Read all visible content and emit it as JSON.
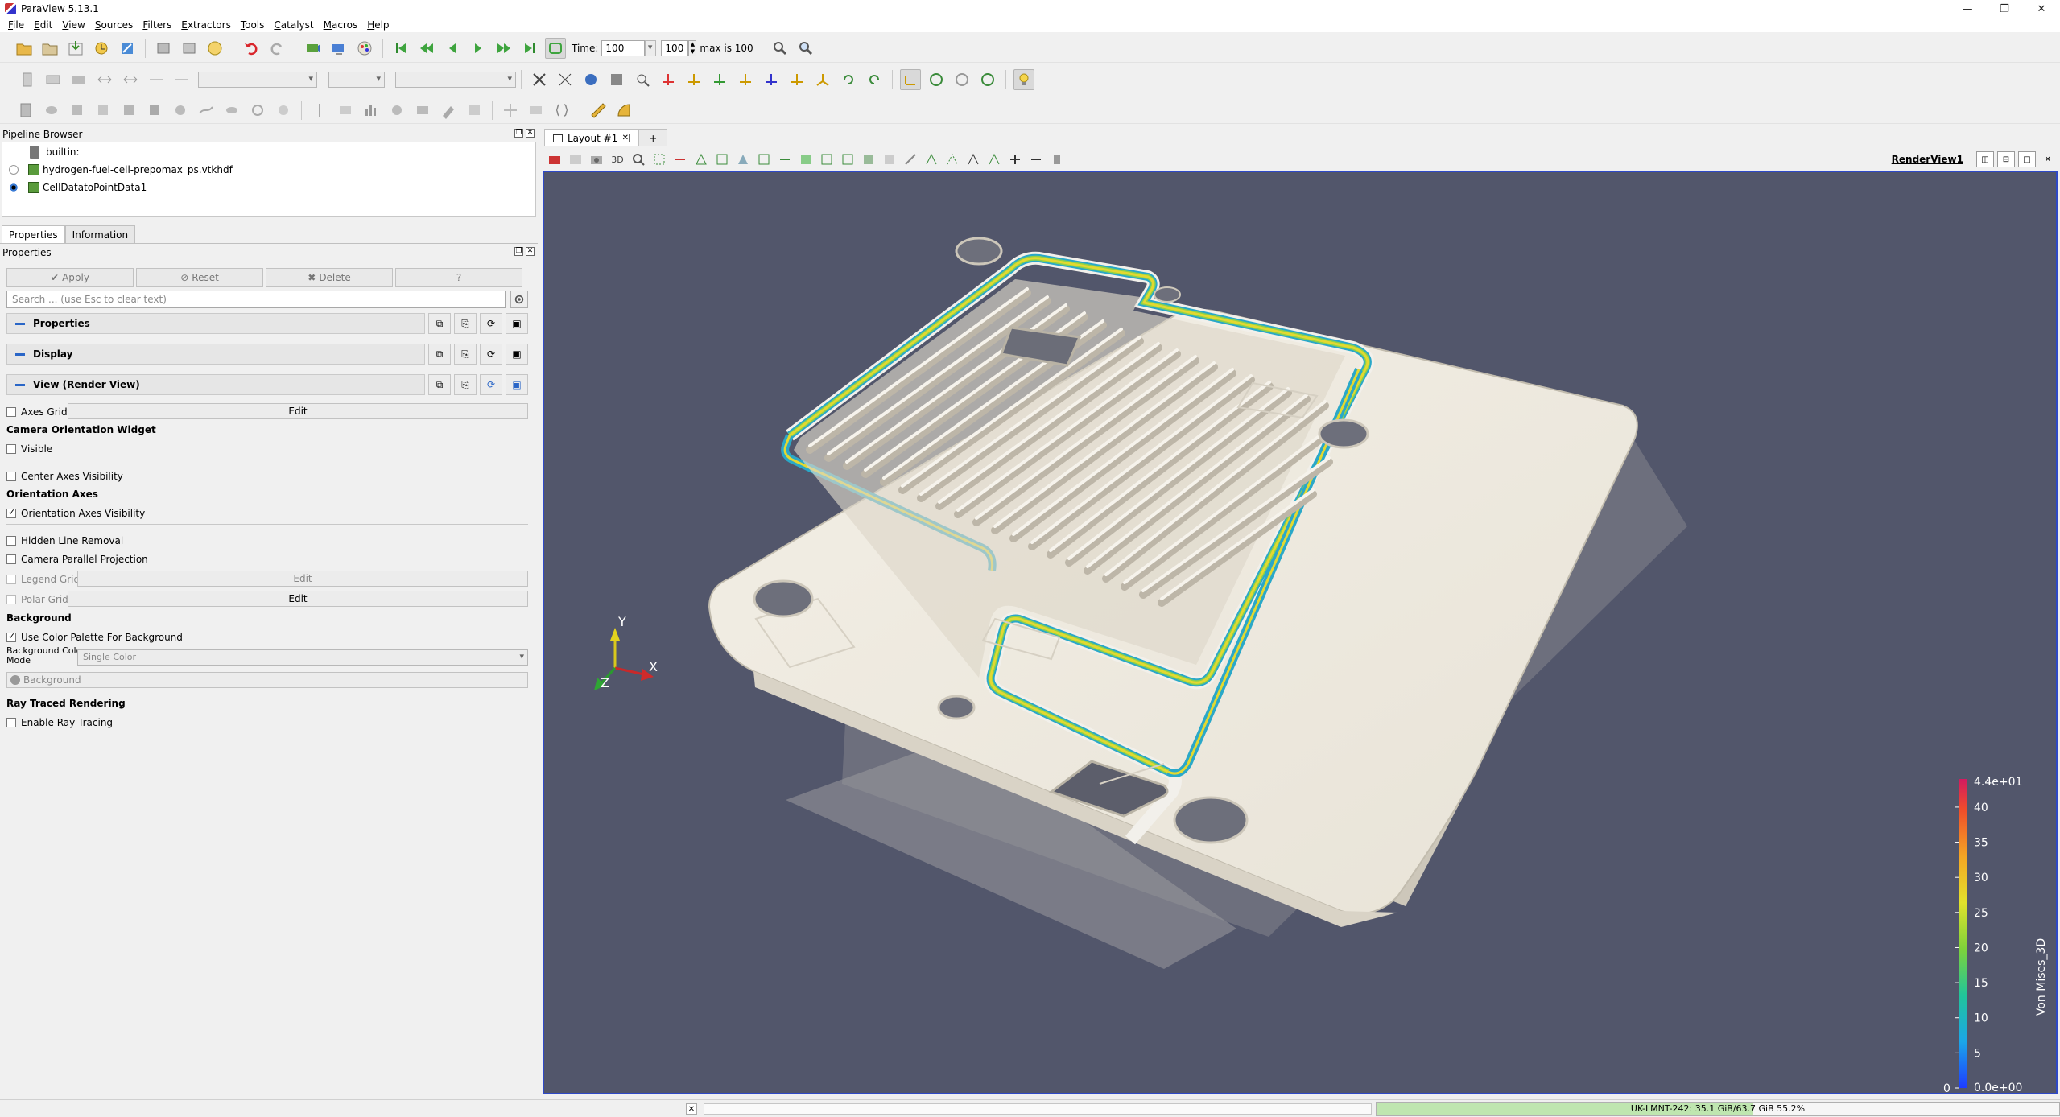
{
  "window": {
    "title": "ParaView 5.13.1",
    "controls": [
      "—",
      "❐",
      "✕"
    ]
  },
  "menu": [
    "File",
    "Edit",
    "View",
    "Sources",
    "Filters",
    "Extractors",
    "Tools",
    "Catalyst",
    "Macros",
    "Help"
  ],
  "time_toolbar": {
    "time_label": "Time:",
    "time_value": "100",
    "step_value": "100",
    "max_label": "max is 100"
  },
  "pipeline_browser": {
    "title": "Pipeline Browser",
    "items": [
      {
        "label": "builtin:",
        "type": "server"
      },
      {
        "label": "hydrogen-fuel-cell-prepomax_ps.vtkhdf",
        "visible": false
      },
      {
        "label": "CellDatatoPointData1",
        "visible": true
      }
    ]
  },
  "panel_tabs": [
    "Properties",
    "Information"
  ],
  "properties": {
    "title": "Properties",
    "apply": "Apply",
    "reset": "Reset",
    "delete": "Delete",
    "help": "?",
    "search_placeholder": "Search ... (use Esc to clear text)",
    "sections": [
      "Properties",
      "Display",
      "View (Render View)"
    ],
    "axes_grid": "Axes Grid",
    "edit": "Edit",
    "camera_widget_group": "Camera Orientation Widget",
    "visible": "Visible",
    "center_axes": "Center Axes Visibility",
    "orientation_group": "Orientation Axes",
    "orientation_visibility": "Orientation Axes Visibility",
    "hidden_line": "Hidden Line Removal",
    "camera_parallel": "Camera Parallel Projection",
    "legend_grid": "Legend Grid",
    "polar_grid": "Polar Grid",
    "background_group": "Background",
    "use_palette": "Use Color Palette For Background",
    "bg_mode_label_1": "Background Color",
    "bg_mode_label_2": "Mode",
    "bg_mode_value": "Single Color",
    "background_btn": "Background",
    "ray_group": "Ray Traced Rendering",
    "enable_ray": "Enable Ray Tracing"
  },
  "layout": {
    "tab_label": "Layout #1",
    "add_tab": "+",
    "render_view_label": "RenderView1"
  },
  "view_toolbar": {
    "mode_3d": "3D"
  },
  "colorbar": {
    "title": "Von Mises_3D",
    "max_label": "4.4e+01",
    "min_label": "0.0e+00",
    "ticks": [
      "40",
      "35",
      "30",
      "25",
      "20",
      "15",
      "10",
      "5",
      "0"
    ]
  },
  "axes_labels": {
    "x": "X",
    "y": "Y",
    "z": "Z"
  },
  "status": {
    "memory": "UK-LMNT-242: 35.1 GiB/63.7 GiB 55.2%",
    "memory_fraction": 0.552
  }
}
